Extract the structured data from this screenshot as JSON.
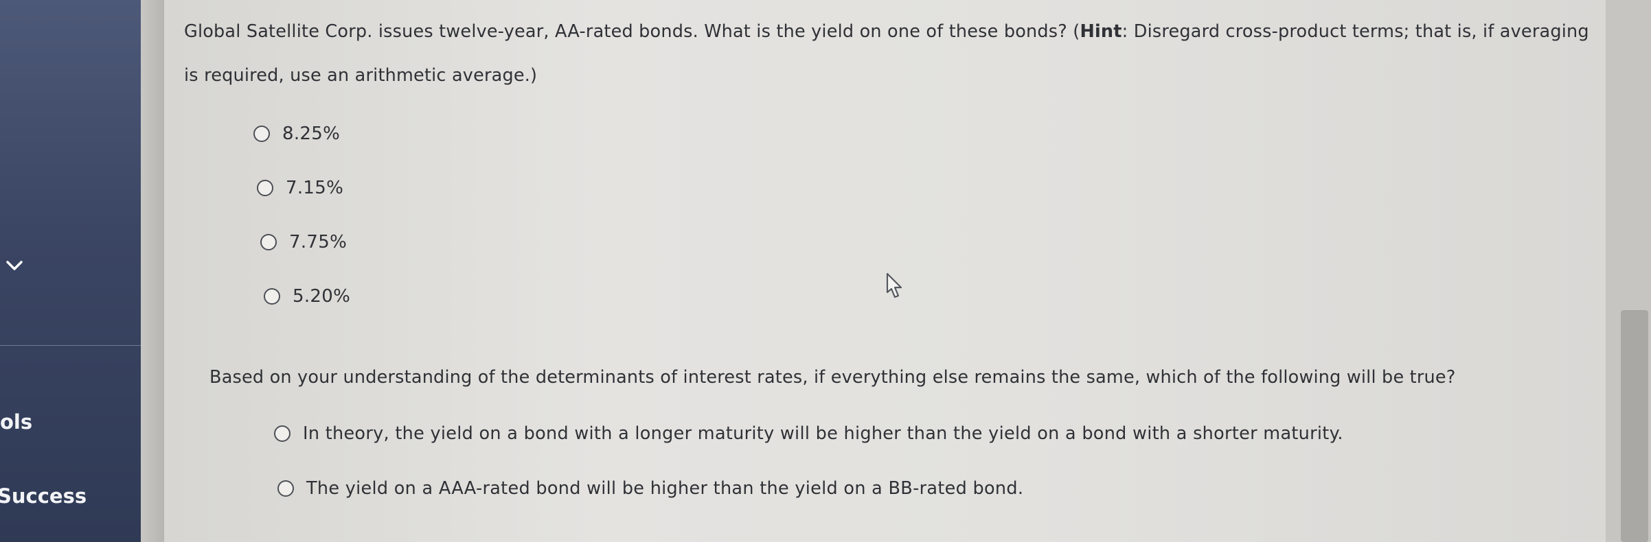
{
  "sidebar": {
    "label_tools": "ols",
    "label_success": "Success"
  },
  "question1": {
    "prompt_part1": "Global Satellite Corp. issues twelve-year, AA-rated bonds. What is the yield on one of these bonds? (",
    "hint_label": "Hint",
    "prompt_part2": ": Disregard cross-product terms; that is, if averaging is required, use an arithmetic average.)",
    "options": [
      "8.25%",
      "7.15%",
      "7.75%",
      "5.20%"
    ]
  },
  "question2": {
    "prompt": "Based on your understanding of the determinants of interest rates, if everything else remains the same, which of the following will be true?",
    "options": [
      "In theory, the yield on a bond with a longer maturity will be higher than the yield on a bond with a shorter maturity.",
      "The yield on a AAA-rated bond will be higher than the yield on a BB-rated bond."
    ]
  }
}
